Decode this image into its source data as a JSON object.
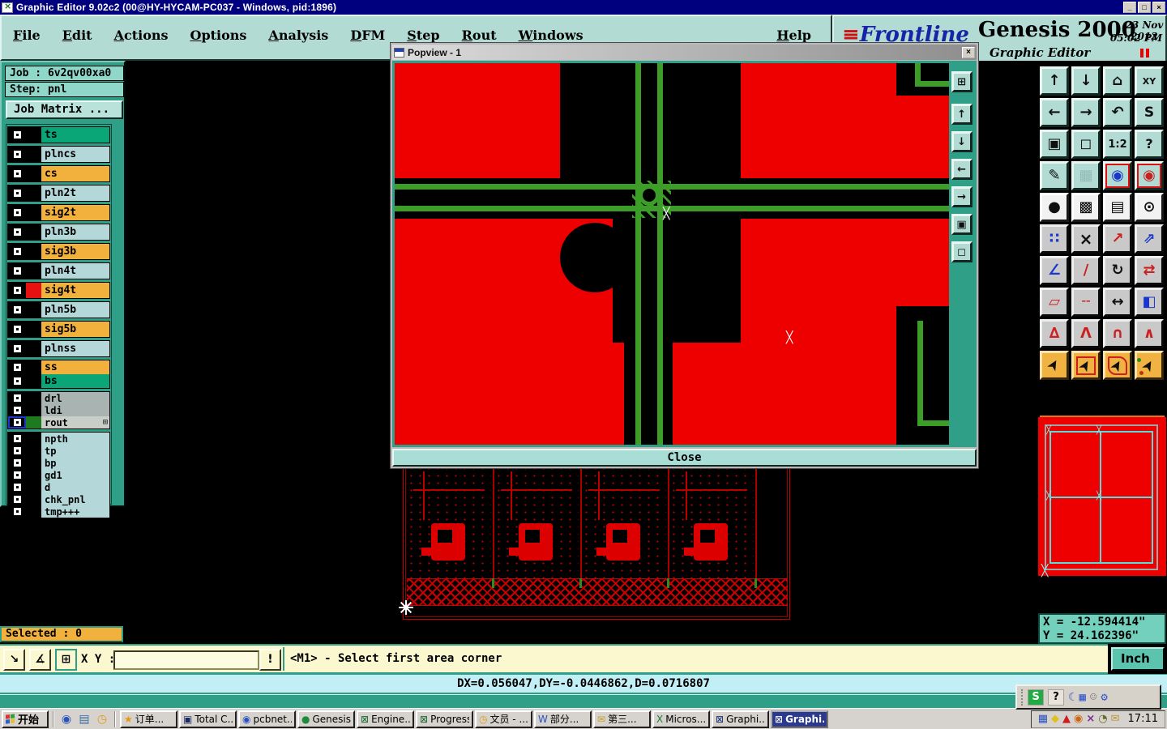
{
  "titlebar": {
    "title": "Graphic Editor 9.02c2 (00@HY-HYCAM-PC037 - Windows, pid:1896)",
    "minimize_glyph": "_",
    "maximize_glyph": "□",
    "close_glyph": "×"
  },
  "menu": {
    "items": [
      "File",
      "Edit",
      "Actions",
      "Options",
      "Analysis",
      "DFM",
      "Step",
      "Rout",
      "Windows",
      "Help"
    ]
  },
  "brand": {
    "logo_prefix": "≡",
    "logo": "Frontline",
    "product": "Genesis 2000",
    "date": "23 Nov 2012",
    "time": "05:02 PM",
    "app": "Graphic Editor"
  },
  "job": {
    "job": "Job : 6v2qv00xa0",
    "step": "Step: pnl",
    "matrix": "Job Matrix ..."
  },
  "layers": [
    {
      "name": "ts",
      "label_style": "background:#0aa678",
      "chip_style": "background:#000000"
    },
    {
      "name": "plncs",
      "label_style": "background:#b4d8da",
      "chip_style": "background:#000000"
    },
    {
      "name": "cs",
      "label_style": "background:#f2b13c",
      "chip_style": "background:#000000"
    },
    {
      "name": "pln2t",
      "label_style": "background:#b4d8da",
      "chip_style": "background:#000000"
    },
    {
      "name": "sig2t",
      "label_style": "background:#f2b13c",
      "chip_style": "background:#000000"
    },
    {
      "name": "pln3b",
      "label_style": "background:#b4d8da",
      "chip_style": "background:#000000"
    },
    {
      "name": "sig3b",
      "label_style": "background:#f2b13c",
      "chip_style": "background:#000000"
    },
    {
      "name": "pln4t",
      "label_style": "background:#b4d8da",
      "chip_style": "background:#000000"
    },
    {
      "name": "sig4t",
      "label_style": "background:#f2b13c",
      "chip_style": "background:#e81010"
    },
    {
      "name": "pln5b",
      "label_style": "background:#b4d8da",
      "chip_style": "background:#000000"
    },
    {
      "name": "sig5b",
      "label_style": "background:#f2b13c",
      "chip_style": "background:#000000"
    },
    {
      "name": "plnss",
      "label_style": "background:#b4d8da",
      "chip_style": "background:#000000"
    },
    {
      "name": "ss",
      "label_style": "background:#f2b13c",
      "chip_style": "background:#000000"
    },
    {
      "name": "bs",
      "label_style": "background:#0aa678",
      "chip_style": "background:#000000"
    },
    {
      "name": "drl",
      "label_style": "background:#a9b4b2",
      "chip_style": "background:#000000"
    },
    {
      "name": "ldi",
      "label_style": "background:#a9b4b2",
      "chip_style": "background:#000000"
    },
    {
      "name": "rout",
      "label_style": "background:#c9cec9",
      "chip_style": "background:#1e7a1e",
      "grid_glyph": "⊞"
    },
    {
      "name": "npth",
      "label_style": "background:#b4d8da",
      "chip_style": "background:#000000"
    },
    {
      "name": "tp",
      "label_style": "background:#b4d8da",
      "chip_style": "background:#000000"
    },
    {
      "name": "bp",
      "label_style": "background:#b4d8da",
      "chip_style": "background:#000000"
    },
    {
      "name": "gd1",
      "label_style": "background:#b4d8da",
      "chip_style": "background:#000000"
    },
    {
      "name": "d",
      "label_style": "background:#b4d8da",
      "chip_style": "background:#000000"
    },
    {
      "name": "chk_pnl",
      "label_style": "background:#b4d8da",
      "chip_style": "background:#000000"
    },
    {
      "name": "tmp+++",
      "label_style": "background:#b4d8da",
      "chip_style": "background:#000000"
    }
  ],
  "popview": {
    "title": "Popview - 1",
    "close": "Close",
    "close_glyph": "×",
    "side_buttons": [
      {
        "name": "copy-window",
        "glyph": "⊞"
      },
      {
        "name": "pan-up",
        "glyph": "↑"
      },
      {
        "name": "pan-down",
        "glyph": "↓"
      },
      {
        "name": "pan-left",
        "glyph": "←"
      },
      {
        "name": "pan-right",
        "glyph": "→"
      },
      {
        "name": "zoom-in",
        "glyph": "▣"
      },
      {
        "name": "zoom-out",
        "glyph": "◻"
      }
    ]
  },
  "toolbar": {
    "buttons": [
      {
        "name": "pan-up",
        "glyph": "↑",
        "style": "color:#101010"
      },
      {
        "name": "pan-down",
        "glyph": "↓",
        "style": "color:#101010"
      },
      {
        "name": "home-view",
        "glyph": "⌂",
        "style": "color:#101010"
      },
      {
        "name": "window-xy",
        "glyph": "XY",
        "style": "color:#101010;font-size:11px"
      },
      {
        "name": "pan-left",
        "glyph": "←",
        "style": "color:#101010"
      },
      {
        "name": "pan-right",
        "glyph": "→",
        "style": "color:#101010"
      },
      {
        "name": "previous-view",
        "glyph": "↶",
        "style": "color:#101010"
      },
      {
        "name": "serpentine-view",
        "glyph": "S",
        "style": "color:#101010;font-size:17px"
      },
      {
        "name": "zoom-window",
        "glyph": "▣",
        "style": "color:#101010"
      },
      {
        "name": "zoom-margins",
        "glyph": "◻",
        "style": "color:#101010"
      },
      {
        "name": "zoom-ratio",
        "glyph": "1:2",
        "style": "color:#101010;font-size:13px"
      },
      {
        "name": "help",
        "glyph": "?",
        "style": "color:#101010;font-size:16px"
      },
      {
        "name": "setup-tools",
        "glyph": "✎",
        "style": "color:#101010"
      },
      {
        "name": "snap-grid",
        "glyph": "▦",
        "style": "color:#93bab4"
      },
      {
        "name": "display-config-1",
        "glyph": "◉",
        "style": "color:#1a36cc"
      },
      {
        "name": "display-config-2",
        "glyph": "◉",
        "style": "color:#cc2020"
      },
      {
        "name": "symbol-reference",
        "glyph": "●",
        "style": "color:#101010"
      },
      {
        "name": "layer-compare",
        "glyph": "▩",
        "style": "color:#cc2020"
      },
      {
        "name": "measure-ruler",
        "glyph": "▤",
        "style": "color:#101010"
      },
      {
        "name": "pad-reference",
        "glyph": "⊙",
        "style": "color:#101010"
      },
      {
        "name": "net-points",
        "glyph": "∷",
        "style": "color:#1a36cc"
      },
      {
        "name": "delete-object",
        "glyph": "×",
        "style": "color:#101010;font-size:20px"
      },
      {
        "name": "copy-object",
        "glyph": "↗",
        "style": "color:#cc2020"
      },
      {
        "name": "move-object",
        "glyph": "⇗",
        "style": "color:#1a36cc"
      },
      {
        "name": "measure-angle",
        "glyph": "∠",
        "style": "color:#1a36cc"
      },
      {
        "name": "add-line",
        "glyph": "∕",
        "style": "color:#cc2020;font-size:18px"
      },
      {
        "name": "rotate-object",
        "glyph": "↻",
        "style": "color:#101010"
      },
      {
        "name": "mirror-object",
        "glyph": "⇄",
        "style": "color:#cc2020"
      },
      {
        "name": "resize-object",
        "glyph": "▱",
        "style": "color:#cc2020"
      },
      {
        "name": "break-line",
        "glyph": "╌",
        "style": "color:#cc2020;font-size:18px"
      },
      {
        "name": "line-width",
        "glyph": "↔",
        "style": "color:#101010"
      },
      {
        "name": "surface-tool",
        "glyph": "◧",
        "style": "color:#1a36cc"
      },
      {
        "name": "select-mode-1",
        "glyph": "∆",
        "style": "color:#cc2020"
      },
      {
        "name": "select-mode-2",
        "glyph": "Λ",
        "style": "color:#cc2020"
      },
      {
        "name": "select-mode-3",
        "glyph": "∩",
        "style": "color:#cc2020"
      },
      {
        "name": "select-mode-4",
        "glyph": "∧",
        "style": "color:#cc2020"
      },
      {
        "name": "select-single",
        "glyph": "➤",
        "style": "color:#101010"
      },
      {
        "name": "select-rectangle",
        "glyph": "➤",
        "style": "color:#101010"
      },
      {
        "name": "select-polygon",
        "glyph": "➤",
        "style": "color:#101010"
      },
      {
        "name": "select-net",
        "glyph": "➤",
        "style": "color:#101010"
      }
    ]
  },
  "overview": {
    "x": "X = -12.594414\"",
    "y": "Y = 24.162396\""
  },
  "statusbar": {
    "selected": "Selected : 0",
    "xy_label": "X Y :",
    "xy_value": "",
    "bang": "!",
    "prompt": "<M1> - Select first area corner",
    "delta": "DX=0.056047,DY=-0.0446862,D=0.0716807",
    "units": "Inch",
    "cmd_icons": [
      {
        "name": "area-zoom",
        "glyph": "↘"
      },
      {
        "name": "measure-mode",
        "glyph": "∡"
      },
      {
        "name": "tile-windows",
        "glyph": "⊞"
      }
    ]
  },
  "langbar": {
    "buttons": [
      {
        "name": "ime-s",
        "glyph": "S"
      },
      {
        "name": "ime-help",
        "glyph": "?"
      },
      {
        "name": "ime-moon",
        "glyph": "☾",
        "style": "color:#3355cc"
      },
      {
        "name": "ime-keyboard",
        "glyph": "▦",
        "style": "color:#3355cc"
      },
      {
        "name": "ime-user",
        "glyph": "☺",
        "style": "color:#888888"
      },
      {
        "name": "ime-tools",
        "glyph": "⚙",
        "style": "color:#3355cc"
      }
    ]
  },
  "taskbar": {
    "start": "开始",
    "quicklaunch": [
      {
        "name": "browser",
        "glyph": "◉",
        "style": "color:#2a52be"
      },
      {
        "name": "desktop",
        "glyph": "▤",
        "style": "color:#3a6ea5"
      },
      {
        "name": "scheduler",
        "glyph": "◷",
        "style": "color:#e8960f"
      }
    ],
    "tasks": [
      {
        "label": "订单...",
        "glyph": "★",
        "style": "color:#e8960f"
      },
      {
        "label": "Total C...",
        "glyph": "▣",
        "style": "color:#202860"
      },
      {
        "label": "pcbnet...",
        "glyph": "◉",
        "style": "color:#2a52be"
      },
      {
        "label": "Genesis",
        "glyph": "●",
        "style": "color:#1e8a3c"
      },
      {
        "label": "Engine...",
        "glyph": "⊠",
        "style": "color:#1e6a2e"
      },
      {
        "label": "Progress",
        "glyph": "⊠",
        "style": "color:#1e6a2e"
      },
      {
        "label": "文员 - ...",
        "glyph": "◷",
        "style": "color:#e8960f"
      },
      {
        "label": "部分...",
        "glyph": "W",
        "style": "color:#2a52be"
      },
      {
        "label": "第三...",
        "glyph": "✉",
        "style": "color:#c8a020"
      },
      {
        "label": "Micros...",
        "glyph": "X",
        "style": "color:#1e7a3c"
      },
      {
        "label": "Graphi...",
        "glyph": "⊠",
        "style": "color:#203070"
      },
      {
        "label": "Graphi...",
        "glyph": "⊠",
        "style": "color:#ffffff"
      }
    ],
    "tray": [
      {
        "name": "network",
        "glyph": "▦",
        "style": "color:#2a52be"
      },
      {
        "name": "diamond",
        "glyph": "◆",
        "style": "color:#e0c020"
      },
      {
        "name": "alert",
        "glyph": "▲",
        "style": "color:#cc2020"
      },
      {
        "name": "genesis-tray",
        "glyph": "◉",
        "style": "color:#cc6611"
      },
      {
        "name": "close-app",
        "glyph": "×",
        "style": "color:#7b2d8b;font-weight:bold"
      },
      {
        "name": "clock-app",
        "glyph": "◔",
        "style": "color:#6b6b2a"
      },
      {
        "name": "mail",
        "glyph": "✉",
        "style": "color:#b89838"
      }
    ],
    "clock": "17:11"
  }
}
